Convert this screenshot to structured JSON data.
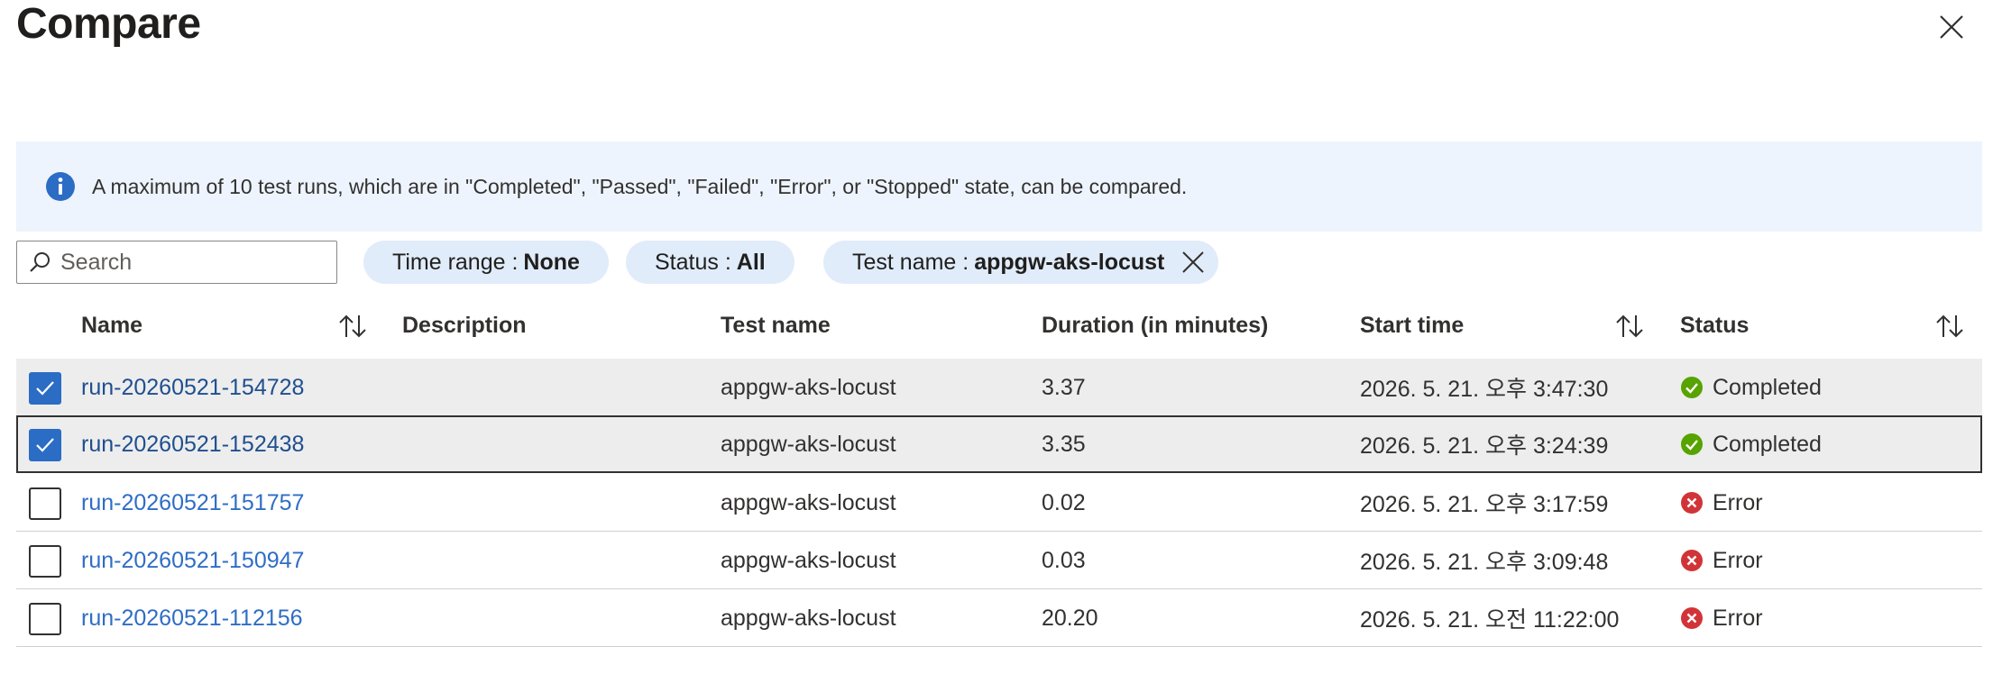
{
  "dialog": {
    "title": "Compare"
  },
  "info": {
    "message": "A maximum of 10 test runs, which are in \"Completed\", \"Passed\", \"Failed\", \"Error\", or \"Stopped\" state, can be compared."
  },
  "search": {
    "placeholder": "Search",
    "value": ""
  },
  "filters": {
    "time_range": {
      "label": "Time range :",
      "value": "None"
    },
    "status": {
      "label": "Status :",
      "value": "All"
    },
    "test_name": {
      "label": "Test name :",
      "value": "appgw-aks-locust"
    }
  },
  "columns": {
    "name": "Name",
    "description": "Description",
    "test_name": "Test name",
    "duration": "Duration (in minutes)",
    "start_time": "Start time",
    "status": "Status"
  },
  "rows": [
    {
      "name": "run-20260521-154728",
      "description": "",
      "test_name": "appgw-aks-locust",
      "duration": "3.37",
      "start_time": "2026. 5. 21. 오후 3:47:30",
      "status": "Completed"
    },
    {
      "name": "run-20260521-152438",
      "description": "",
      "test_name": "appgw-aks-locust",
      "duration": "3.35",
      "start_time": "2026. 5. 21. 오후 3:24:39",
      "status": "Completed"
    },
    {
      "name": "run-20260521-151757",
      "description": "",
      "test_name": "appgw-aks-locust",
      "duration": "0.02",
      "start_time": "2026. 5. 21. 오후 3:17:59",
      "status": "Error"
    },
    {
      "name": "run-20260521-150947",
      "description": "",
      "test_name": "appgw-aks-locust",
      "duration": "0.03",
      "start_time": "2026. 5. 21. 오후 3:09:48",
      "status": "Error"
    },
    {
      "name": "run-20260521-112156",
      "description": "",
      "test_name": "appgw-aks-locust",
      "duration": "20.20",
      "start_time": "2026. 5. 21. 오전 11:22:00",
      "status": "Error"
    }
  ],
  "colors": {
    "accent": "#2b6cc5",
    "link": "#2f6dc6",
    "success": "#57a300",
    "error": "#d13438",
    "info_bg": "#eef4fd",
    "pill_bg": "#e1ecfa"
  }
}
